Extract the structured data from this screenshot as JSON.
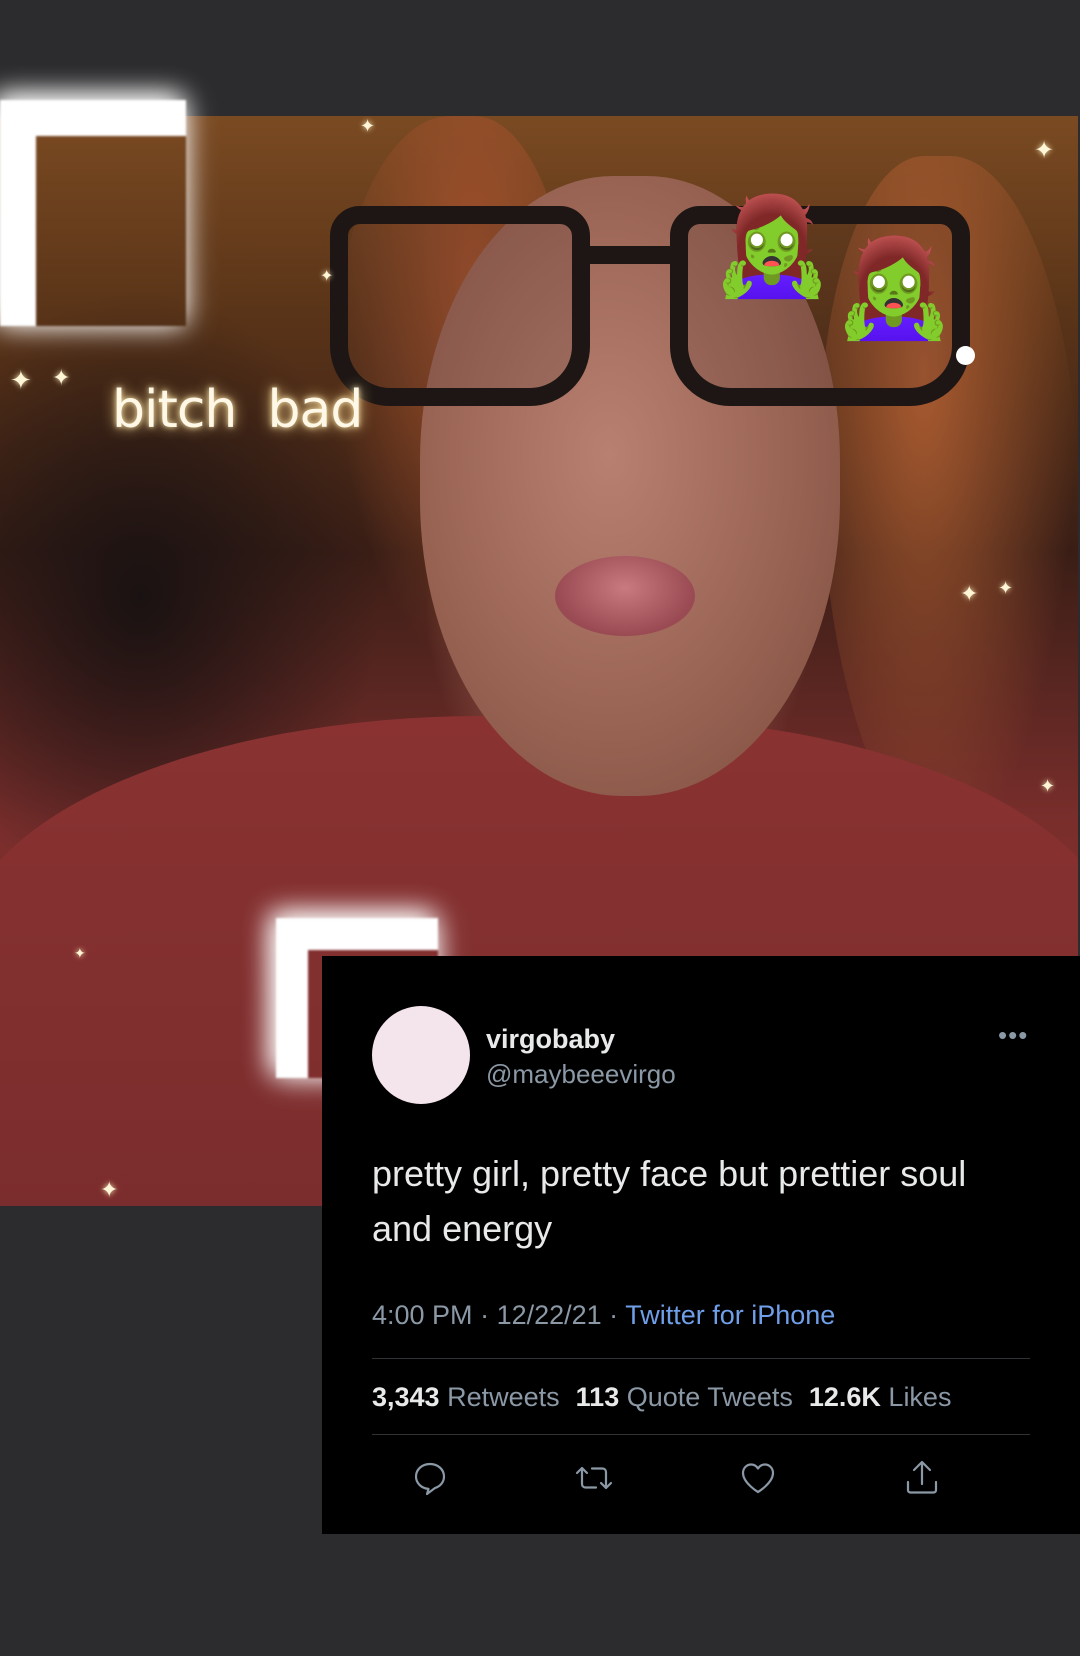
{
  "overlay_text": {
    "glow_words": "bitch  bad"
  },
  "stickers": {
    "zombie_emoji": "🧟‍♀️"
  },
  "tweet": {
    "display_name": "virgobaby",
    "handle": "@maybeeevirgo",
    "more_label": "•••",
    "text": "pretty girl, pretty face but prettier soul and energy",
    "time": "4:00 PM",
    "date": "12/22/21",
    "separator": " · ",
    "source": "Twitter for iPhone",
    "stats": {
      "retweets_count": "3,343",
      "retweets_label": "Retweets",
      "quote_count": "113",
      "quote_label": "Quote Tweets",
      "likes_count": "12.6K",
      "likes_label": "Likes"
    },
    "actions": [
      {
        "icon": "reply-icon"
      },
      {
        "icon": "retweet-icon"
      },
      {
        "icon": "like-icon"
      },
      {
        "icon": "share-icon"
      }
    ]
  },
  "colors": {
    "page_background": "#2c2c2e",
    "tweet_background": "#000000",
    "link_blue": "#6f9fe8",
    "muted_text": "#8b98a5",
    "avatar_fill": "#f4e4ec"
  }
}
